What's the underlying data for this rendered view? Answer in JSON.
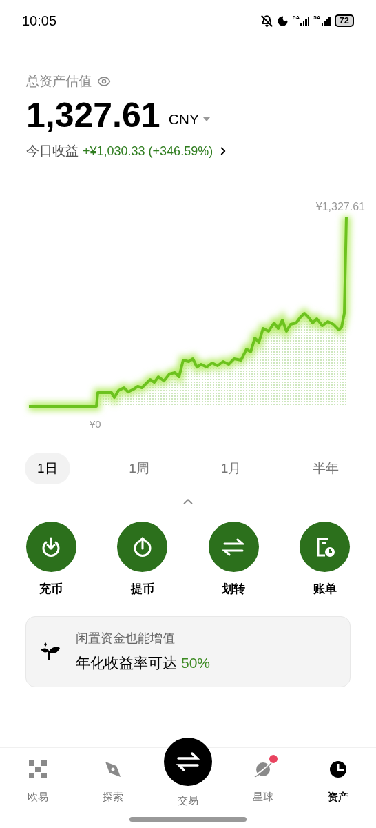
{
  "status_bar": {
    "time": "10:05",
    "networks": [
      "5A",
      "5A"
    ],
    "battery": "72"
  },
  "header": {
    "title": "总资产估值",
    "amount": "1,327.61",
    "currency": "CNY",
    "today_label": "今日收益",
    "today_value": "+¥1,030.33 (+346.59%)"
  },
  "chart": {
    "max_label": "¥1,327.61",
    "min_label": "¥0"
  },
  "periods": [
    {
      "label": "1日",
      "selected": true
    },
    {
      "label": "1周",
      "selected": false
    },
    {
      "label": "1月",
      "selected": false
    },
    {
      "label": "半年",
      "selected": false
    }
  ],
  "actions": [
    {
      "kind": "deposit",
      "label": "充币"
    },
    {
      "kind": "withdraw",
      "label": "提币"
    },
    {
      "kind": "transfer",
      "label": "划转"
    },
    {
      "kind": "bill",
      "label": "账单"
    }
  ],
  "promo": {
    "title": "闲置资金也能增值",
    "text": "年化收益率可达",
    "highlight": "50%"
  },
  "nav": [
    {
      "kind": "home",
      "label": "欧易",
      "selected": false,
      "badge": false
    },
    {
      "kind": "explore",
      "label": "探索",
      "selected": false,
      "badge": false
    },
    {
      "kind": "trade",
      "label": "交易",
      "selected": false,
      "badge": false
    },
    {
      "kind": "planet",
      "label": "星球",
      "selected": false,
      "badge": true
    },
    {
      "kind": "assets",
      "label": "资产",
      "selected": true,
      "badge": false
    }
  ]
}
